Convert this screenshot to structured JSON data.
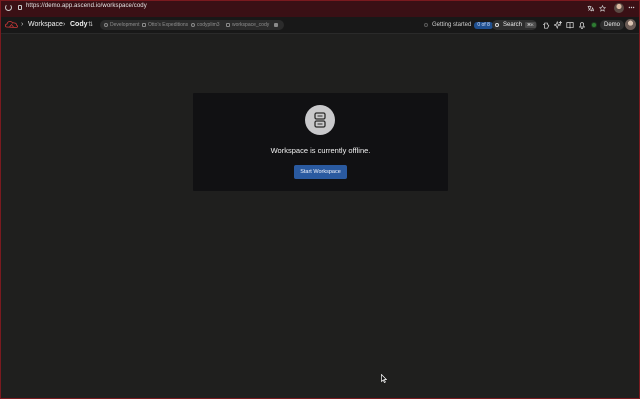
{
  "browser": {
    "url": "https://demo.app.ascend.io/workspace/cody"
  },
  "header": {
    "breadcrumb": [
      "Workspace",
      "Cody"
    ],
    "context": [
      {
        "label": "Development",
        "icon": "environment-icon"
      },
      {
        "label": "Otto's Expeditions",
        "icon": "project-icon"
      },
      {
        "label": "codyplim3",
        "icon": "branch-icon"
      },
      {
        "label": "workspace_cody",
        "icon": "database-icon"
      }
    ],
    "getting_started": {
      "label": "Getting started",
      "badge": "0 of 8"
    },
    "search": {
      "label": "Search",
      "shortcut": "⌘K"
    },
    "demo_label": "Demo",
    "colors": {
      "badge": "#1f4f8f",
      "status_green": "#2e7d32"
    }
  },
  "main": {
    "message": "Workspace is currently offline.",
    "start_button": "Start Workspace",
    "icon": "server-icon",
    "colors": {
      "button": "#2a5aa0",
      "card": "#111113"
    }
  }
}
